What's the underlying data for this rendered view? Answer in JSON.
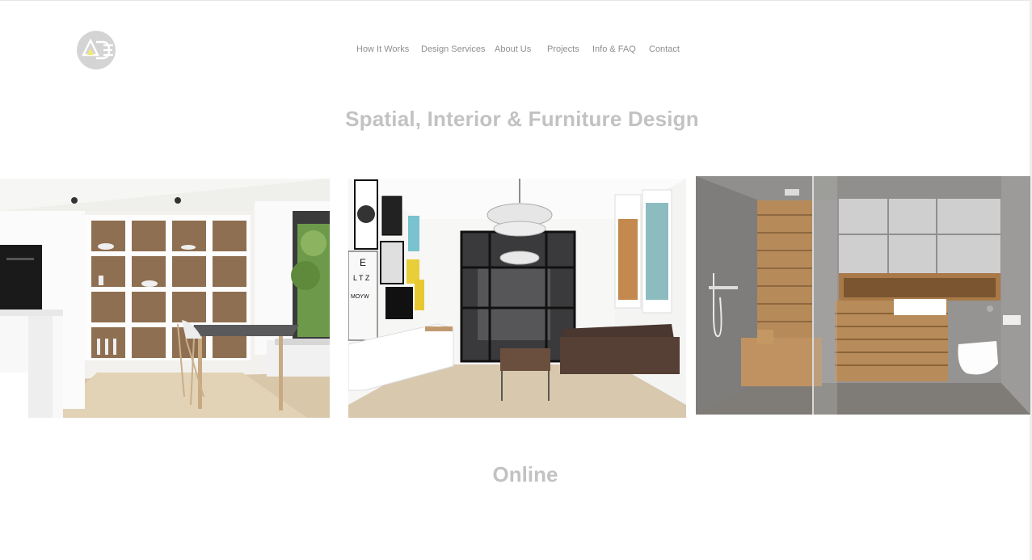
{
  "header": {
    "logo": {
      "icon": "ade-logo"
    },
    "nav": [
      "How It Works",
      "Design Services",
      "About Us",
      "Projects",
      "Info & FAQ",
      "Contact"
    ]
  },
  "hero": {
    "title": "Spatial, Interior & Furniture Design"
  },
  "gallery": [
    {
      "subject": "kitchen-dining-with-shelving-photo"
    },
    {
      "subject": "living-room-with-chandelier-photo"
    },
    {
      "subject": "bathroom-with-wood-cabinets-photo"
    }
  ],
  "section": {
    "title": "Online"
  }
}
